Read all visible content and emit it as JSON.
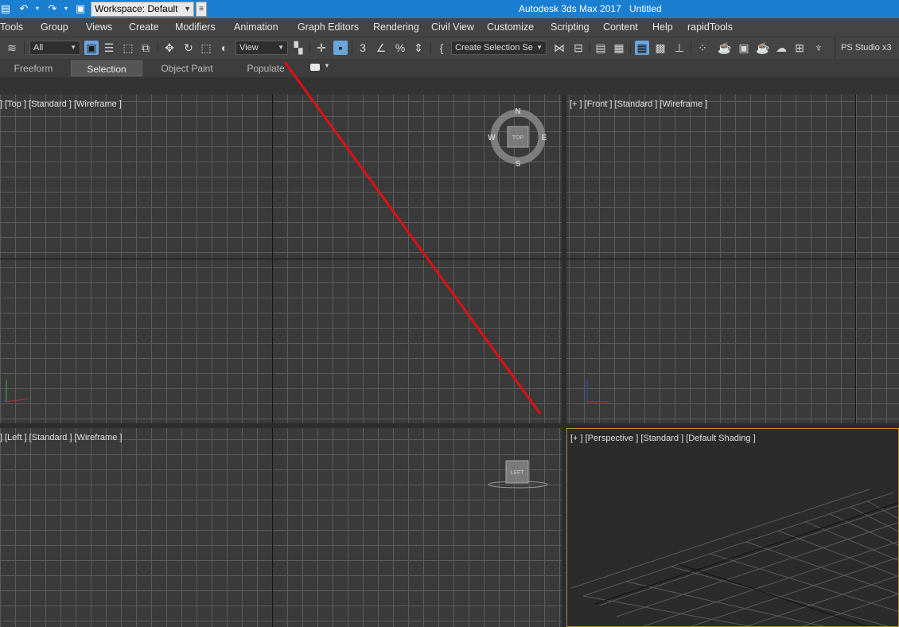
{
  "window": {
    "workspace_combo": "Workspace: Default",
    "app_title": "Autodesk 3ds Max 2017",
    "doc_title": "Untitled"
  },
  "menu": {
    "items": [
      "Tools",
      "Group",
      "Views",
      "Create",
      "Modifiers",
      "Animation",
      "Graph Editors",
      "Rendering",
      "Civil View",
      "Customize",
      "Scripting",
      "Content",
      "Help",
      "rapidTools"
    ]
  },
  "toolbar": {
    "filter_combo": "All",
    "ref_coord_combo": "View",
    "named_selection_combo": "Create Selection Se",
    "ps_studio": "PS Studio x3"
  },
  "ribbon": {
    "tabs": [
      "Freeform",
      "Selection",
      "Object Paint",
      "Populate"
    ],
    "active_tab": "Selection"
  },
  "viewports": {
    "top": "] [Top ] [Standard ] [Wireframe ]",
    "front": "[+ ] [Front ] [Standard ] [Wireframe ]",
    "left": "] [Left ] [Standard ] [Wireframe ]",
    "perspective": "[+ ] [Perspective ] [Standard ] [Default Shading ]"
  },
  "viewcube": {
    "top_face": "TOP",
    "left_face": "LEFT",
    "compass": [
      "N",
      "S",
      "W",
      "E"
    ]
  },
  "colors": {
    "titlebar": "#1b7fd1",
    "annotation_line": "#e01010",
    "active_viewport_border": "#b29436"
  }
}
